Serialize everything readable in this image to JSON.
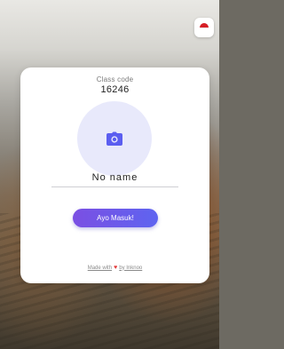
{
  "class_code": {
    "label": "Class code",
    "value": "16246"
  },
  "profile": {
    "name": "No name",
    "avatar_icon": "camera-icon"
  },
  "enter_button": {
    "label": "Ayo Masuk!"
  },
  "footer": {
    "made_with": "Made with",
    "by": "by Inknoo",
    "heart_icon": "heart-icon"
  },
  "language_flag": {
    "icon": "flag-icon",
    "colors": [
      "#d61f26",
      "#ffffff"
    ]
  },
  "colors": {
    "accent_start": "#7b4fe3",
    "accent_end": "#5e64f0",
    "avatar_bg": "#e8e9fb",
    "camera": "#5b5ef0"
  }
}
